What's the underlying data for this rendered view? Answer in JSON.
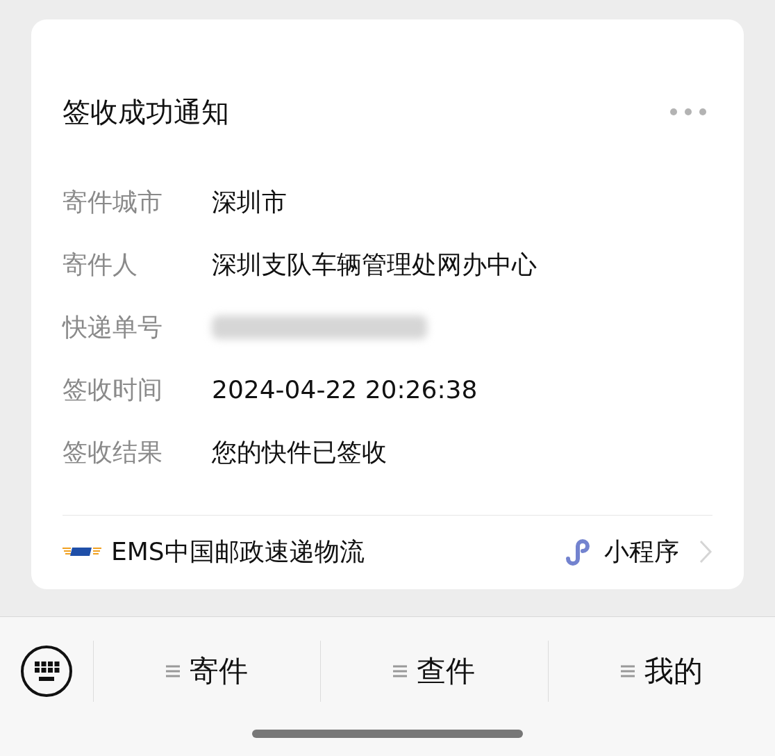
{
  "card": {
    "title": "签收成功通知",
    "fields": [
      {
        "label": "寄件城市",
        "value": "深圳市",
        "kind": "text"
      },
      {
        "label": "寄件人",
        "value": "深圳支队车辆管理处网办中心",
        "kind": "text"
      },
      {
        "label": "快递单号",
        "kind": "redacted"
      },
      {
        "label": "签收时间",
        "value": "2024-04-22 20:26:38",
        "kind": "text"
      },
      {
        "label": "签收结果",
        "value": "您的快件已签收",
        "kind": "text"
      }
    ],
    "footer": {
      "source": "EMS中国邮政速递物流",
      "link": "小程序"
    }
  },
  "menu_bar": {
    "items": [
      {
        "label": "寄件"
      },
      {
        "label": "查件"
      },
      {
        "label": "我的"
      }
    ]
  }
}
